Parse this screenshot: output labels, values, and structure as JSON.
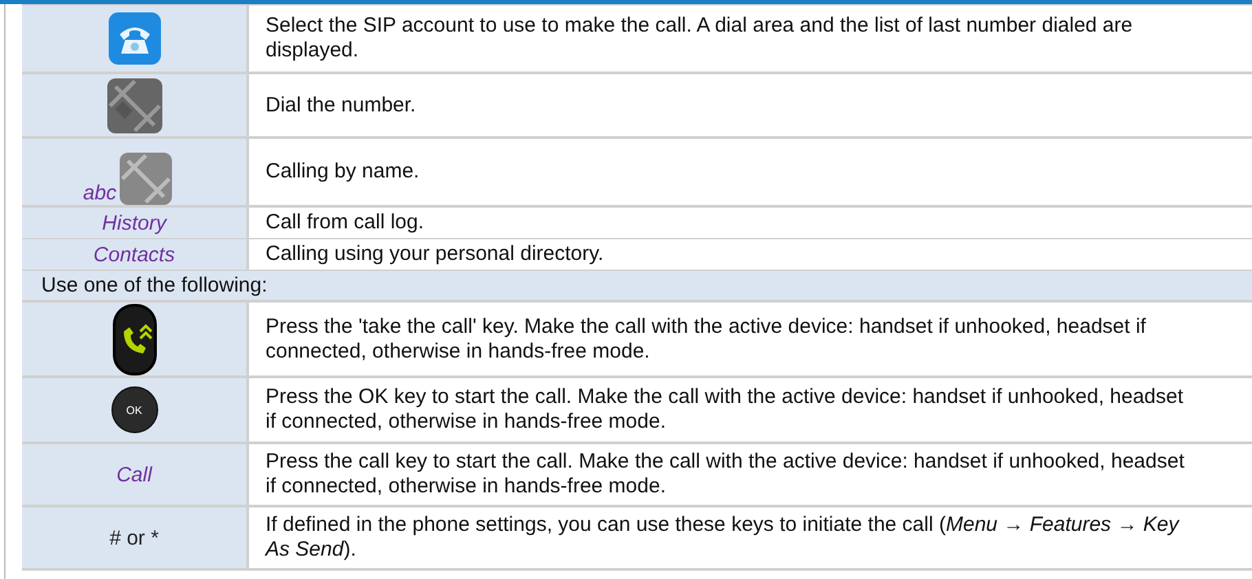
{
  "rows": [
    {
      "kind": "handset",
      "description": "Select the SIP account to use to make the call. A dial area and the list of last number dialed are displayed."
    },
    {
      "kind": "keypad",
      "description": "Dial the number."
    },
    {
      "kind": "letterkeys",
      "label": "abc",
      "italic": true,
      "description": "Calling by name."
    },
    {
      "kind": "label",
      "label": "History",
      "italic": true,
      "description": "Call from call log."
    },
    {
      "kind": "label",
      "label": "Contacts",
      "italic": true,
      "description": "Calling using your personal directory."
    },
    {
      "kind": "section",
      "text": "Use one of the following:"
    },
    {
      "kind": "callkey",
      "description": "Press the 'take the call' key. Make the call with the active device: handset if unhooked, headset if connected, otherwise in hands-free mode."
    },
    {
      "kind": "okkey",
      "key_label": "OK",
      "description": "Press the OK key to start the call. Make the call with the active device: handset if unhooked, headset if connected, otherwise in hands-free mode."
    },
    {
      "kind": "label",
      "label": "Call",
      "italic": true,
      "description": "Press the call key to start the call. Make the call with the active device: handset if unhooked, headset if connected, otherwise in hands-free mode."
    },
    {
      "kind": "label",
      "label": "# or *",
      "italic": false,
      "description": "If defined in the phone settings, you can use these keys to initiate the call (*Menu* → *Features* → *Key As Send*)."
    }
  ]
}
